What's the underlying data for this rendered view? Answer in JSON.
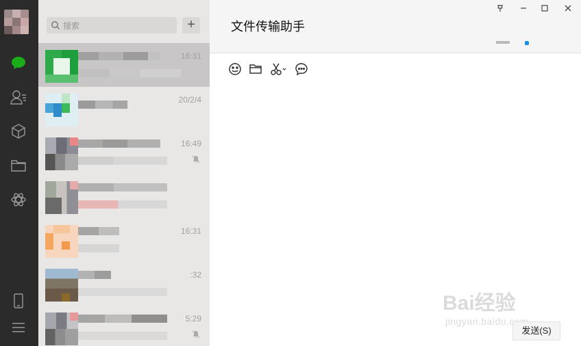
{
  "window": {
    "pin_icon": "pin-icon",
    "min_icon": "minimize-icon",
    "max_icon": "maximize-icon",
    "close_icon": "close-icon"
  },
  "sidebar": {
    "items": [
      {
        "icon": "chat-icon",
        "color": "#1aad19"
      },
      {
        "icon": "contacts-icon",
        "color": "#9a9a9a"
      },
      {
        "icon": "cube-icon",
        "color": "#9a9a9a"
      },
      {
        "icon": "folder-icon",
        "color": "#9a9a9a"
      },
      {
        "icon": "moments-icon",
        "color": "#9a9a9a"
      },
      {
        "icon": "phone-icon",
        "color": "#9a9a9a"
      },
      {
        "icon": "menu-icon",
        "color": "#9a9a9a"
      }
    ]
  },
  "search": {
    "placeholder": "搜索"
  },
  "add_button": "+",
  "sessions": [
    {
      "time": "16:31",
      "active": true,
      "muted": false
    },
    {
      "time": "20/2/4",
      "active": false,
      "muted": false
    },
    {
      "time": "16:49",
      "active": false,
      "muted": true
    },
    {
      "time": "",
      "active": false,
      "muted": false
    },
    {
      "time": "16:31",
      "active": false,
      "muted": false
    },
    {
      "time": ":32",
      "active": false,
      "muted": false
    },
    {
      "time": "5:29",
      "active": false,
      "muted": true
    }
  ],
  "chat": {
    "title": "文件传输助手",
    "toolbar": [
      "emoji-icon",
      "folder-icon",
      "scissors-icon",
      "chat-bubble-icon"
    ],
    "send_label": "发送(S)"
  },
  "watermark": {
    "text": "Bai经验",
    "url": "jingyan.baidu.com"
  },
  "colors": {
    "accent": "#1aad19",
    "sidebar_bg": "#2b2b2b",
    "list_bg": "#e9e7e6",
    "active_bg": "#c8c6c6"
  }
}
